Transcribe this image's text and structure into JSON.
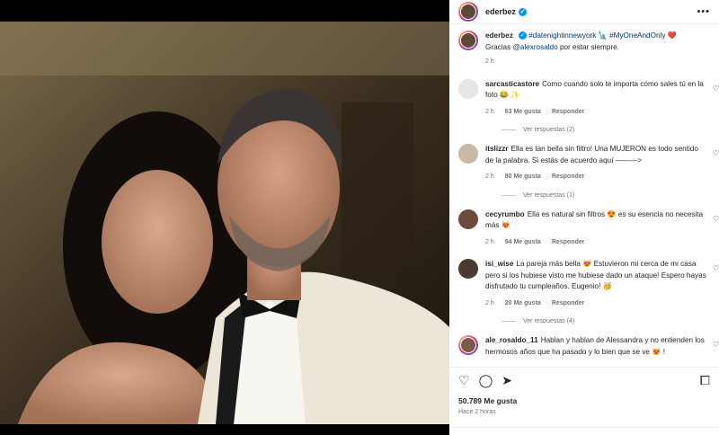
{
  "post": {
    "username": "ederbez",
    "verified_mark": "✓",
    "caption_tags": "#datenightinnewyork 🗽 #MyOneAndOnly ❤️",
    "caption_line2_pre": "Gracias ",
    "caption_mention": "@alexrosaldo",
    "caption_line2_post": " por estar siempre.",
    "caption_time": "2 h",
    "more": "•••"
  },
  "comments": [
    {
      "user": "sarcasticastore",
      "text": "Como cuando solo te importa cómo sales tú en la foto 😂 ✨",
      "time": "2 h",
      "likes": "63 Me gusta",
      "reply": "Responder",
      "view_replies": "Ver respuestas (2)"
    },
    {
      "user": "itslizzr",
      "text": "Ella es tan bella sin filtro! Una MUJERON es todo sentido de la palabra. Si estás de acuerdo aquí ———>",
      "time": "2 h",
      "likes": "80 Me gusta",
      "reply": "Responder",
      "view_replies": "Ver respuestas (1)"
    },
    {
      "user": "cecyrumbo",
      "text": "Ella es natural sin filtros 😍 es su esencia no necesita más 😻",
      "time": "2 h",
      "likes": "94 Me gusta",
      "reply": "Responder",
      "view_replies": ""
    },
    {
      "user": "isi_wise",
      "text": "La pareja más bella 😻 Estuvieron mi cerca de mi casa pero si los hubiese visto me hubiese dado un ataque! Espero hayas disfrutado tu cumpleaños. Eugenio! 🥳",
      "time": "2 h",
      "likes": "20 Me gusta",
      "reply": "Responder",
      "view_replies": "Ver respuestas (4)"
    },
    {
      "user": "ale_rosaldo_11",
      "text": "Hablan y hablan de Alessandra y no entienden los hermosos años que ha pasado y lo bien que se ve 😻 !",
      "time": "",
      "likes": "",
      "reply": "",
      "view_replies": ""
    }
  ],
  "footer": {
    "likes": "50.789 Me gusta",
    "time": "Hace 2 horas"
  },
  "icons": {
    "heart": "♡",
    "comment": "◯",
    "share": "➤",
    "save": "⧠"
  }
}
